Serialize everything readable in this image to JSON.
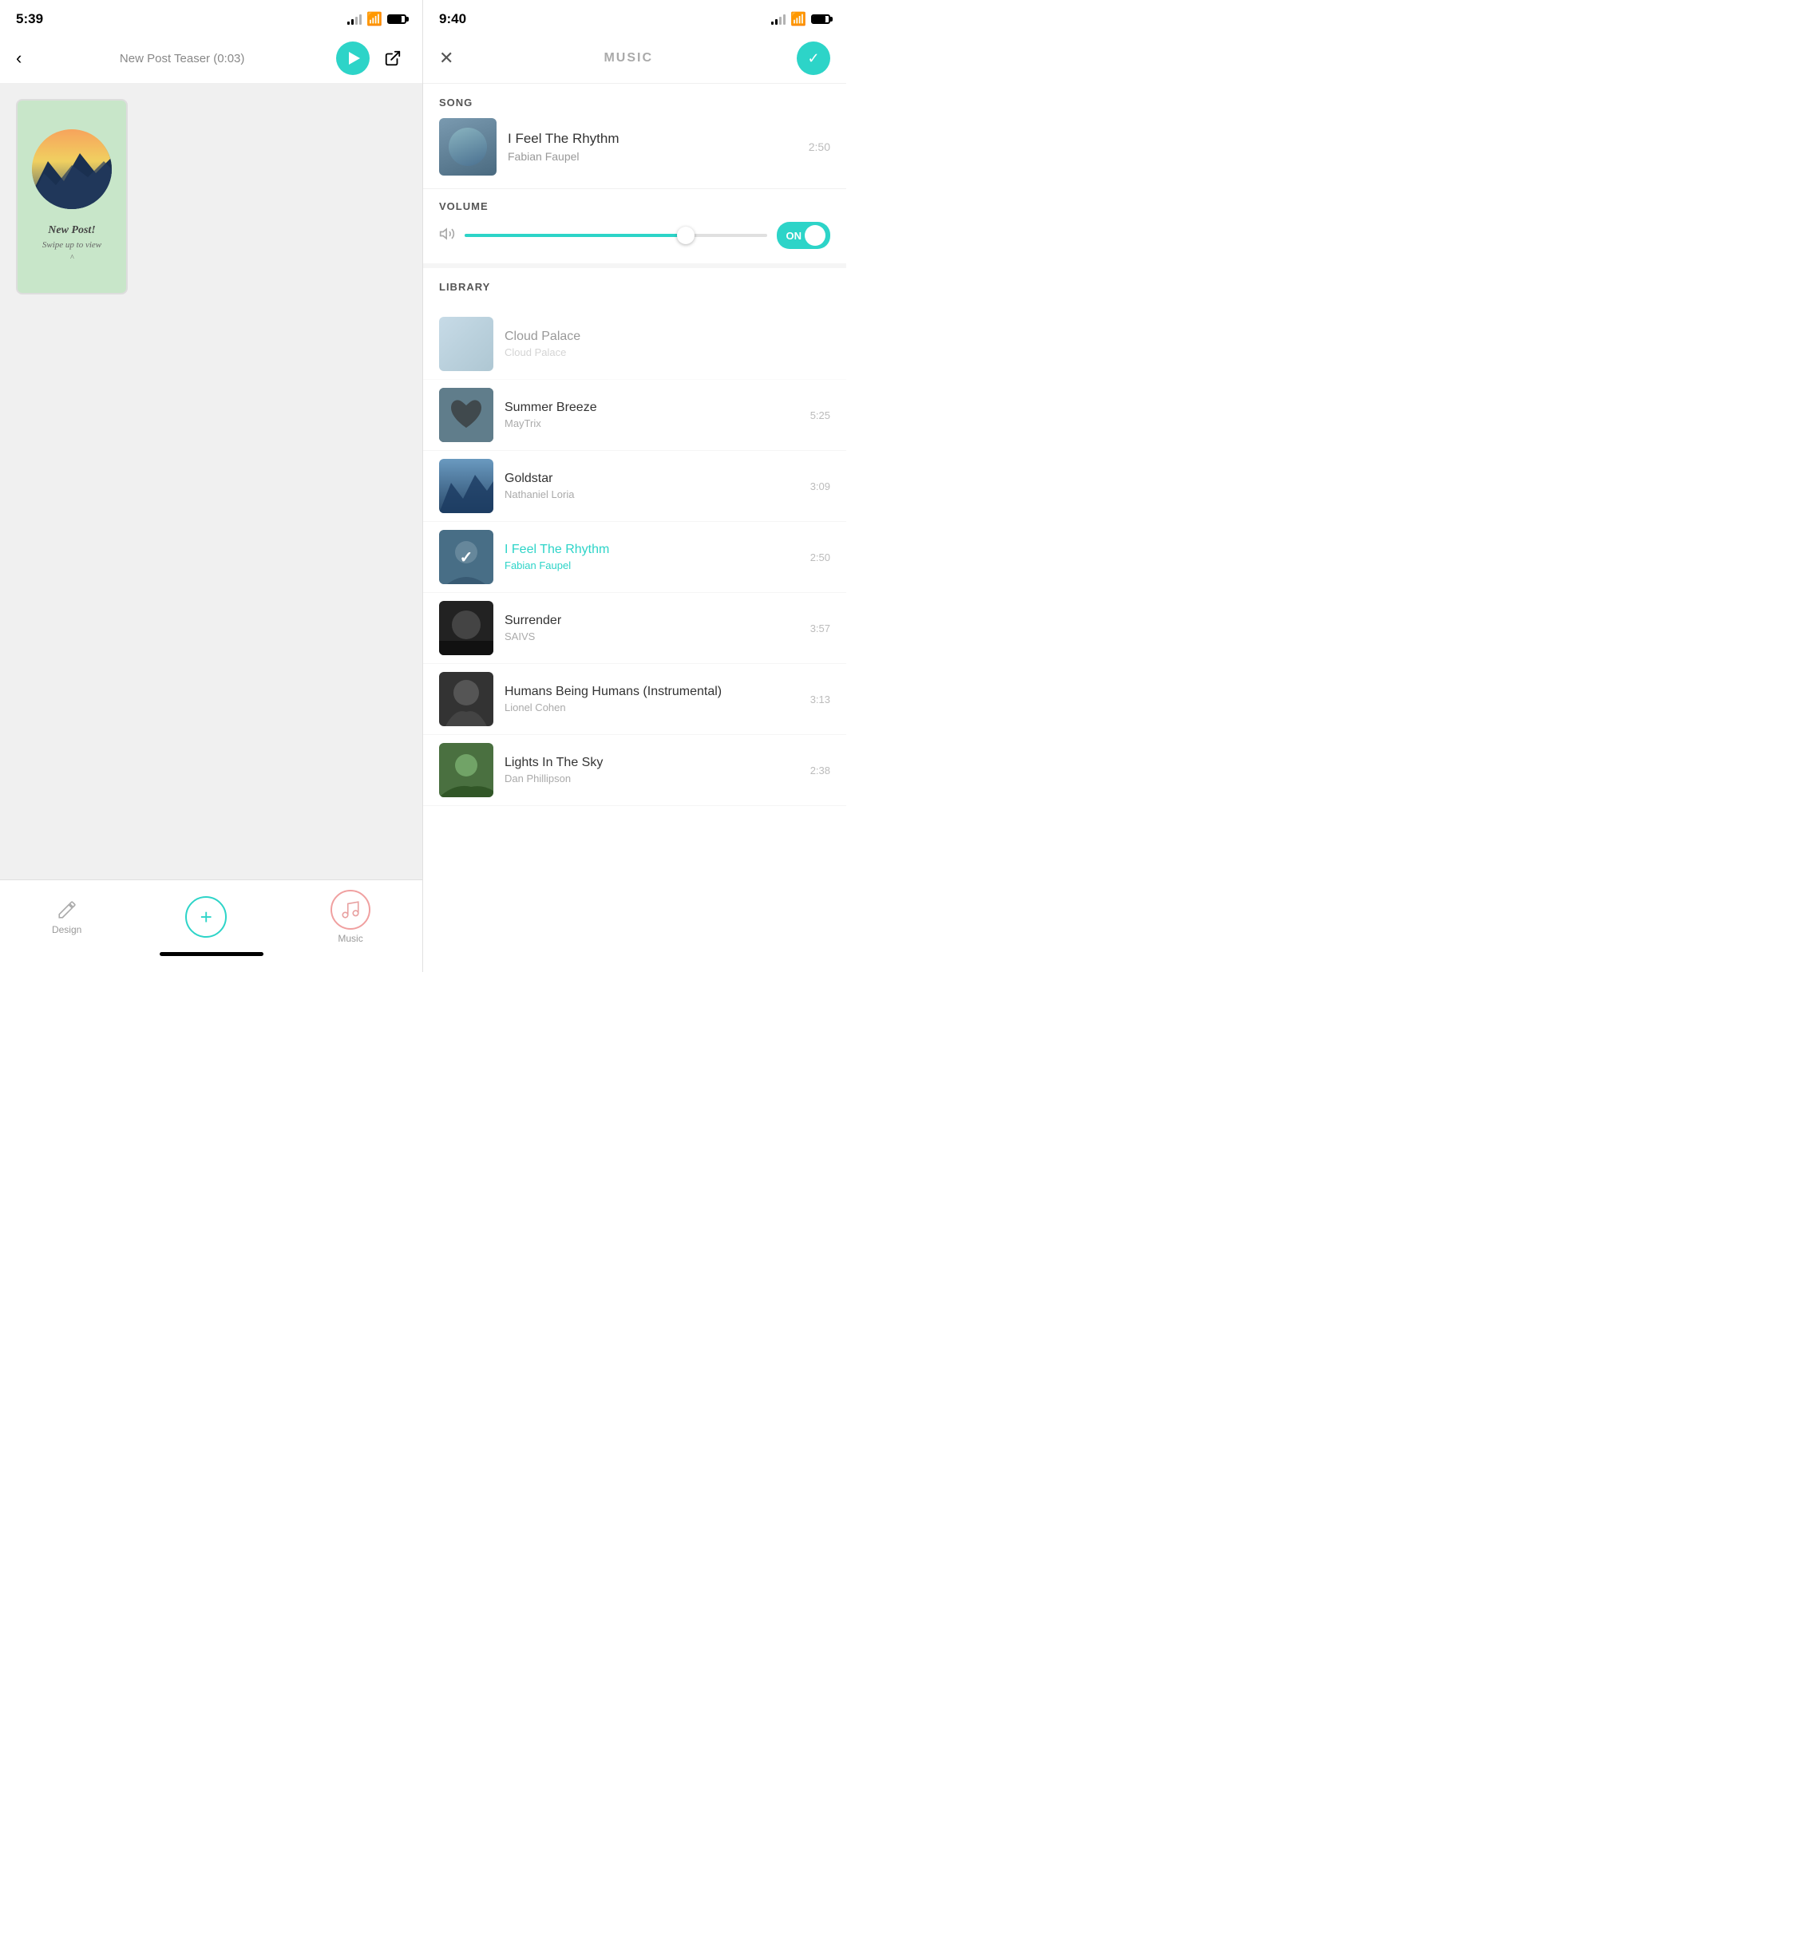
{
  "left": {
    "status_time": "5:39",
    "header": {
      "title": "New Post Teaser (0:03)",
      "back_label": "‹",
      "share_icon": "↗"
    },
    "preview": {
      "text_line1": "New Post!",
      "text_line2": "Swipe up to view",
      "text_caret": "^"
    },
    "bottom_nav": {
      "design_label": "Design",
      "add_label": "+",
      "music_label": "Music"
    }
  },
  "right": {
    "status_time": "9:40",
    "header": {
      "title": "MUSIC",
      "close_icon": "✕",
      "check_icon": "✓"
    },
    "song_section": {
      "label": "SONG",
      "name": "I Feel The Rhythm",
      "artist": "Fabian Faupel",
      "duration": "2:50"
    },
    "volume_section": {
      "label": "VOLUME",
      "toggle_label": "ON"
    },
    "library": {
      "label": "LIBRARY",
      "items": [
        {
          "name": "Cloud Palace",
          "artist": "Cloud Palace",
          "duration": "",
          "active": false,
          "partial": true,
          "bg": "bg-cloud"
        },
        {
          "name": "Summer Breeze",
          "artist": "MayTrix",
          "duration": "5:25",
          "active": false,
          "partial": false,
          "bg": "bg-blue-gray"
        },
        {
          "name": "Goldstar",
          "artist": "Nathaniel Loria",
          "duration": "3:09",
          "active": false,
          "partial": false,
          "bg": "bg-mountain"
        },
        {
          "name": "I Feel The Rhythm",
          "artist": "Fabian Faupel",
          "duration": "2:50",
          "active": true,
          "partial": false,
          "bg": "bg-person"
        },
        {
          "name": "Surrender",
          "artist": "SAIVS",
          "duration": "3:57",
          "active": false,
          "partial": false,
          "bg": "bg-dark"
        },
        {
          "name": "Humans Being Humans (Instrumental)",
          "artist": "Lionel Cohen",
          "duration": "3:13",
          "active": false,
          "partial": false,
          "bg": "bg-beard"
        },
        {
          "name": "Lights In The Sky",
          "artist": "Dan Phillipson",
          "duration": "2:38",
          "active": false,
          "partial": false,
          "bg": "bg-outdoor"
        }
      ]
    }
  }
}
